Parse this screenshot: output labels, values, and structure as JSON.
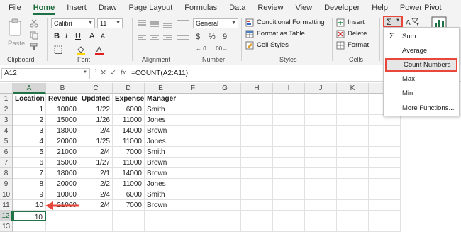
{
  "tabs": [
    "File",
    "Home",
    "Insert",
    "Draw",
    "Page Layout",
    "Formulas",
    "Data",
    "Review",
    "View",
    "Developer",
    "Help",
    "Power Pivot"
  ],
  "ribbon": {
    "clipboard": {
      "label": "Clipboard",
      "paste": "Paste"
    },
    "font": {
      "label": "Font",
      "name": "Calibri",
      "size": "11"
    },
    "alignment": {
      "label": "Alignment"
    },
    "number": {
      "label": "Number",
      "format": "General"
    },
    "styles": {
      "label": "Styles",
      "conditional": "Conditional Formatting",
      "table": "Format as Table",
      "cell_styles": "Cell Styles"
    },
    "cells": {
      "label": "Cells",
      "insert": "Insert",
      "delete": "Delete",
      "format": "Format"
    },
    "editing": {
      "sigma": "Σ"
    }
  },
  "formula_bar": {
    "name_box": "A12",
    "fx": "fx",
    "formula": "=COUNT(A2:A11)"
  },
  "sheet": {
    "columns": [
      "A",
      "B",
      "C",
      "D",
      "E",
      "F",
      "G",
      "H",
      "I",
      "J",
      "K",
      "L"
    ],
    "rows": [
      "1",
      "2",
      "3",
      "4",
      "5",
      "6",
      "7",
      "8",
      "9",
      "10",
      "11",
      "12",
      "13"
    ],
    "headers": [
      "Location",
      "Revenue",
      "Updated",
      "Expenses",
      "Manager"
    ],
    "data": [
      [
        "1",
        "10000",
        "1/22",
        "6000",
        "Smith"
      ],
      [
        "2",
        "15000",
        "1/26",
        "11000",
        "Jones"
      ],
      [
        "3",
        "18000",
        "2/4",
        "14000",
        "Brown"
      ],
      [
        "4",
        "20000",
        "1/25",
        "11000",
        "Jones"
      ],
      [
        "5",
        "21000",
        "2/4",
        "7000",
        "Smith"
      ],
      [
        "6",
        "15000",
        "1/27",
        "11000",
        "Brown"
      ],
      [
        "7",
        "18000",
        "2/1",
        "14000",
        "Brown"
      ],
      [
        "8",
        "20000",
        "2/2",
        "11000",
        "Jones"
      ],
      [
        "9",
        "10000",
        "2/4",
        "6000",
        "Smith"
      ],
      [
        "10",
        "21000",
        "2/4",
        "7000",
        "Brown"
      ]
    ],
    "result": "10"
  },
  "autosum_menu": {
    "items": [
      "Sum",
      "Average",
      "Count Numbers",
      "Max",
      "Min",
      "More Functions..."
    ],
    "selected": "Count Numbers"
  },
  "colors": {
    "accent_green": "#1e7145",
    "highlight_red": "#e8473b",
    "selection_green": "#217346"
  }
}
